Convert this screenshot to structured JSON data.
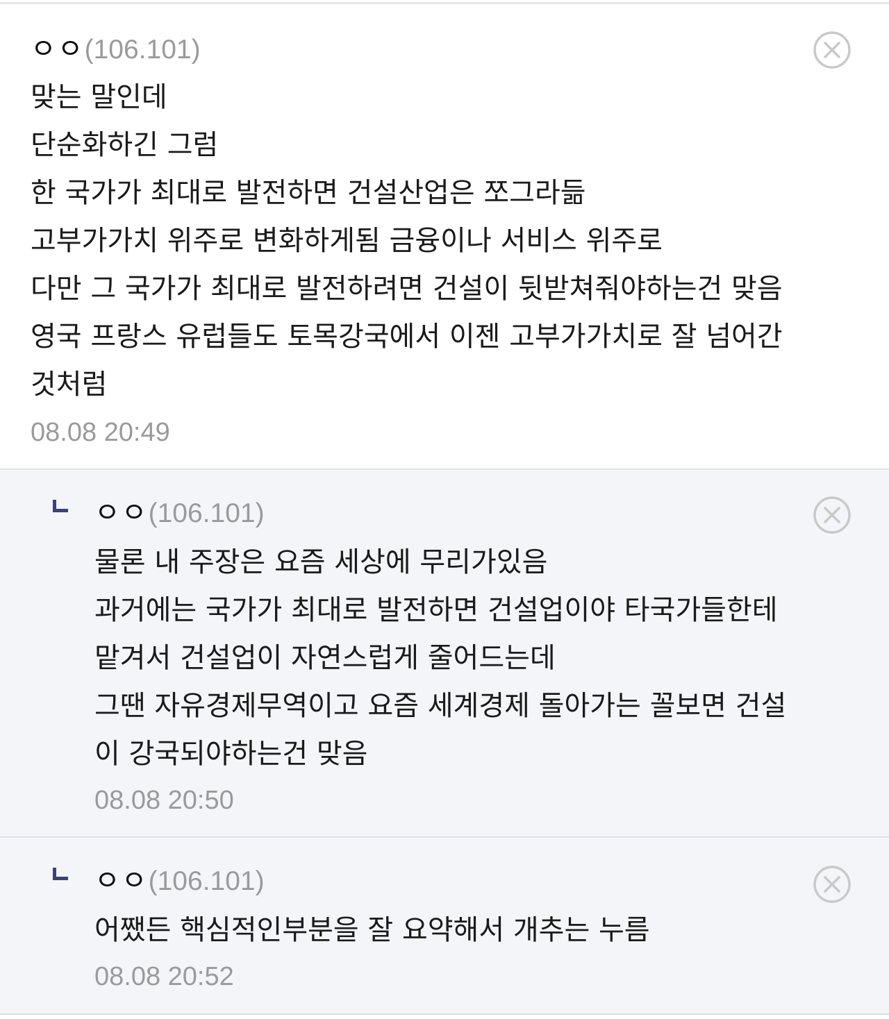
{
  "colors": {
    "reply_background": "#f4f5f9",
    "reply_marker": "#3b4275",
    "meta_text": "#9a9a9a",
    "close_icon": "#c9c9c9"
  },
  "comments": [
    {
      "nickname": "ㅇㅇ",
      "ip": "(106.101)",
      "lines": [
        "맞는 말인데",
        "단순화하긴 그럼",
        "한 국가가 최대로 발전하면 건설산업은 쪼그라듦",
        "고부가가치 위주로 변화하게됨 금융이나 서비스 위주로",
        "다만 그 국가가 최대로 발전하려면 건설이 뒷받쳐줘야하는건 맞음",
        "영국 프랑스 유럽들도 토목강국에서 이젠 고부가가치로 잘 넘어간",
        "것처럼"
      ],
      "time": "08.08 20:49",
      "delete_icon": "close-circle-icon"
    },
    {
      "nickname": "ㅇㅇ",
      "ip": "(106.101)",
      "lines": [
        "물론 내 주장은 요즘 세상에 무리가있음",
        "과거에는 국가가 최대로 발전하면 건설업이야 타국가들한테",
        "맡겨서 건설업이 자연스럽게 줄어드는데",
        "그땐 자유경제무역이고 요즘 세계경제 돌아가는 꼴보면 건설",
        "이 강국되야하는건 맞음"
      ],
      "time": "08.08 20:50",
      "delete_icon": "close-circle-icon"
    },
    {
      "nickname": "ㅇㅇ",
      "ip": "(106.101)",
      "lines": [
        "어쨌든 핵심적인부분을 잘 요약해서 개추는 누름"
      ],
      "time": "08.08 20:52",
      "delete_icon": "close-circle-icon"
    }
  ]
}
